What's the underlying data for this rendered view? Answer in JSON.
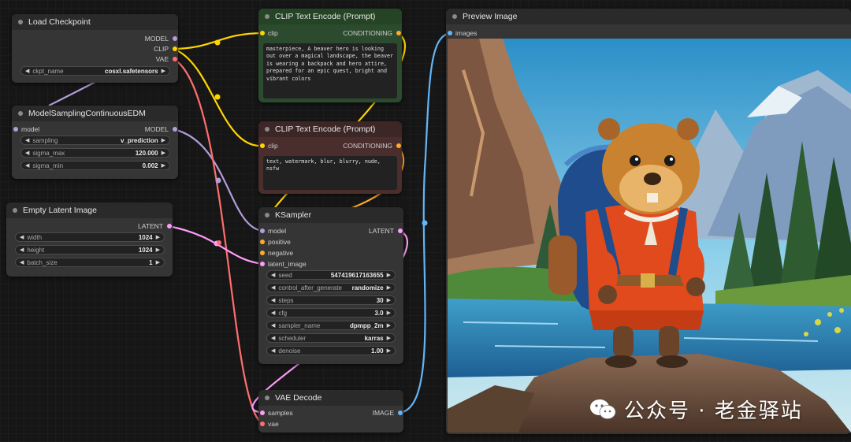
{
  "colors": {
    "model": "#b39ddb",
    "clip": "#ffd500",
    "vae": "#ff6e6e",
    "latent": "#ff9cf9",
    "conditioning": "#ffa931",
    "image": "#64b5f6"
  },
  "nodes": {
    "load_checkpoint": {
      "title": "Load Checkpoint",
      "outputs": [
        "MODEL",
        "CLIP",
        "VAE"
      ],
      "widget": {
        "label": "ckpt_name",
        "value": "cosxl.safetensors"
      }
    },
    "model_sampling": {
      "title": "ModelSamplingContinuousEDM",
      "input": "model",
      "output": "MODEL",
      "widgets": [
        {
          "label": "sampling",
          "value": "v_prediction"
        },
        {
          "label": "sigma_max",
          "value": "120.000"
        },
        {
          "label": "sigma_min",
          "value": "0.002"
        }
      ]
    },
    "empty_latent": {
      "title": "Empty Latent Image",
      "output": "LATENT",
      "widgets": [
        {
          "label": "width",
          "value": "1024"
        },
        {
          "label": "height",
          "value": "1024"
        },
        {
          "label": "batch_size",
          "value": "1"
        }
      ]
    },
    "clip_positive": {
      "title": "CLIP Text Encode (Prompt)",
      "input": "clip",
      "output": "CONDITIONING",
      "text": "masterpiece, A beaver hero is looking out over a magical landscape, the beaver is wearing a backpack and hero attire, prepared for an epic quest, bright and vibrant colors"
    },
    "clip_negative": {
      "title": "CLIP Text Encode (Prompt)",
      "input": "clip",
      "output": "CONDITIONING",
      "text": "text, watermark, blur, blurry, nude, nsfw"
    },
    "ksampler": {
      "title": "KSampler",
      "inputs": [
        "model",
        "positive",
        "negative",
        "latent_image"
      ],
      "output": "LATENT",
      "widgets": [
        {
          "label": "seed",
          "value": "547419617163655"
        },
        {
          "label": "control_after_generate",
          "value": "randomize"
        },
        {
          "label": "steps",
          "value": "30"
        },
        {
          "label": "cfg",
          "value": "3.0"
        },
        {
          "label": "sampler_name",
          "value": "dpmpp_2m"
        },
        {
          "label": "scheduler",
          "value": "karras"
        },
        {
          "label": "denoise",
          "value": "1.00"
        }
      ]
    },
    "vae_decode": {
      "title": "VAE Decode",
      "inputs": [
        "samples",
        "vae"
      ],
      "output": "IMAGE"
    },
    "preview": {
      "title": "Preview Image",
      "input": "images"
    }
  },
  "watermark": {
    "text": "公众号 · 老金驿站",
    "icon": "wechat-icon"
  },
  "icons": {
    "arrow_left": "◀",
    "arrow_right": "▶"
  }
}
